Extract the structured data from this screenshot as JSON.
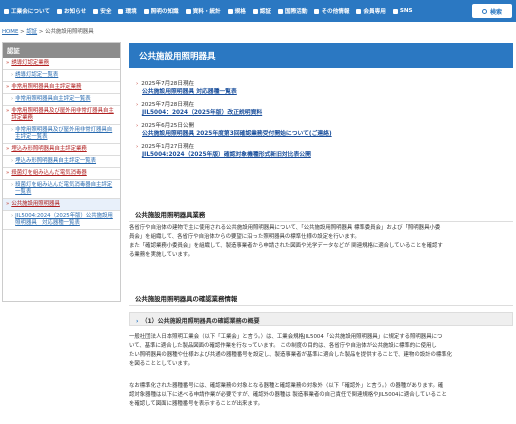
{
  "nav": {
    "items": [
      "工業会について",
      "お知らせ",
      "安全",
      "環境",
      "照明の知識",
      "資料・統計",
      "規格",
      "認証",
      "国際活動",
      "その他情報",
      "会員専用",
      "SNS"
    ],
    "search_label": "検索"
  },
  "breadcrumb": {
    "home": "HOME",
    "sep1": " > ",
    "parent": "認証",
    "sep2": " > ",
    "current": "公共施設用照明器具"
  },
  "sidebar": {
    "heading": "認証",
    "items": [
      {
        "label": "誘導灯認定業務",
        "level": 1
      },
      {
        "label": "誘導灯認定一覧表",
        "level": 2
      },
      {
        "label": "非常用照明器具自主評定業務",
        "level": 1
      },
      {
        "label": "非常用照明器具自主評定一覧表",
        "level": 2
      },
      {
        "label": "非常用照明器具及び屋外用非常灯器具自主評定業務",
        "level": 1
      },
      {
        "label": "非常用照明器具及び屋外用非常灯器具自主評定一覧表",
        "level": 2
      },
      {
        "label": "埋込み形照明器具自主評定業務",
        "level": 1
      },
      {
        "label": "埋込み形照明器具自主評定一覧表",
        "level": 2
      },
      {
        "label": "殺菌灯を組み込んだ電気消毒器",
        "level": 1
      },
      {
        "label": "殺菌灯を組み込んだ電気消毒器自主評定一覧表",
        "level": 2
      },
      {
        "label": "公共施設用照明器具",
        "level": 1
      },
      {
        "label": "JIL5004:2024（2025年版）公共施設用照明器具　対応器種一覧表",
        "level": 2
      }
    ]
  },
  "main": {
    "title": "公共施設用照明器具",
    "news": [
      {
        "date": "2025年7月28日現在",
        "link": "公共施設用照明器具 対応器種一覧表"
      },
      {
        "date": "2025年7月28日現在",
        "link": "JIL5004：2024（2025年版）改正説明資料"
      },
      {
        "date": "2025年6月25日公開",
        "link": "公共施設用照明器具 2025年度第3回確認業務受付開始について(ご連絡)"
      },
      {
        "date": "2025年1月27日現在",
        "link": "JIL5004:2024（2025年版）確認対象機種形式新旧対比表公開"
      }
    ],
    "section1_heading": "公共施設用照明器具業務",
    "section1_lines": [
      "各省庁や自治体の建物で主に使用される公共施設用照明器具について、「公共施設用照明器具 標準委員会」および「照明器具小委",
      "員会」を組織して、各省庁や自治体からの要望に沿った照明器具の標準仕様の設定を行います。",
      "また「確認業務小委員会」を組織して、製造事業者から申請された図面や光学データなどが 関連規格に適合していることを確認す",
      "る業務を実施しています。"
    ],
    "section2_heading": "公共施設用照明器具の確認業務情報",
    "subsection_title": "（1）公共施設用照明器具の確認業務の概要",
    "body1_lines": [
      "一般社団法人日本照明工業会（以下「工業会」と言う。）は、工業会規格JIL5004「公共施設用照明器具」に規定する照明器具につ",
      "いて、基準に適合した製品図面の確認作業を行なっています。 この制度の目的は、各省庁や自治体が公共施設に標準的に使用し",
      "たい照明器具の器種や仕様および共通の器種番号を設定し、製造事業者が基準に適合した製品を提供することで、建物の設計の標準化",
      "を図ることとしています。"
    ],
    "body2_lines": [
      "なお標準化された器種番号には、確認業務の対象となる器種と確認業務の対象外（以下「確認外」と言う。）の器種があります。確",
      "認対象器種は以下に述べる申請作業が必要ですが、確認外の器種は 製造事業者の自己責任で関連規格やJIL5004に適合していること",
      "を確認して図面に器種番号を表示することが出来ます。"
    ]
  }
}
